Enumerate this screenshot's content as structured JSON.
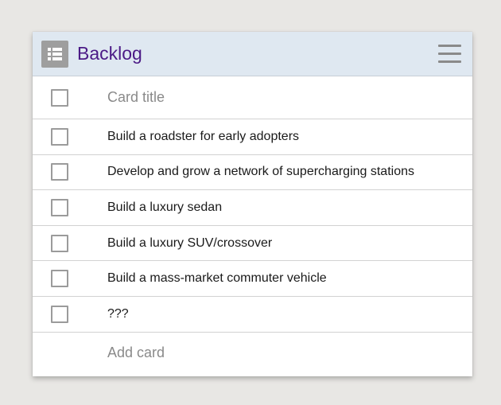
{
  "board": {
    "title": "Backlog",
    "icon": "board-grid-icon",
    "menu_icon": "hamburger-menu-icon"
  },
  "new_card": {
    "placeholder": "Card title"
  },
  "cards": [
    {
      "title": "Build a roadster for early adopters",
      "checked": false
    },
    {
      "title": "Develop and grow a network of supercharging stations",
      "checked": false
    },
    {
      "title": "Build a luxury sedan",
      "checked": false
    },
    {
      "title": "Build a luxury SUV/crossover",
      "checked": false
    },
    {
      "title": "Build a mass-market commuter vehicle",
      "checked": false
    },
    {
      "title": "???",
      "checked": false
    }
  ],
  "footer": {
    "add_card_label": "Add card"
  },
  "colors": {
    "header_bg": "#dfe8f1",
    "title": "#4b1a86",
    "icon_bg": "#9e9e9e"
  }
}
